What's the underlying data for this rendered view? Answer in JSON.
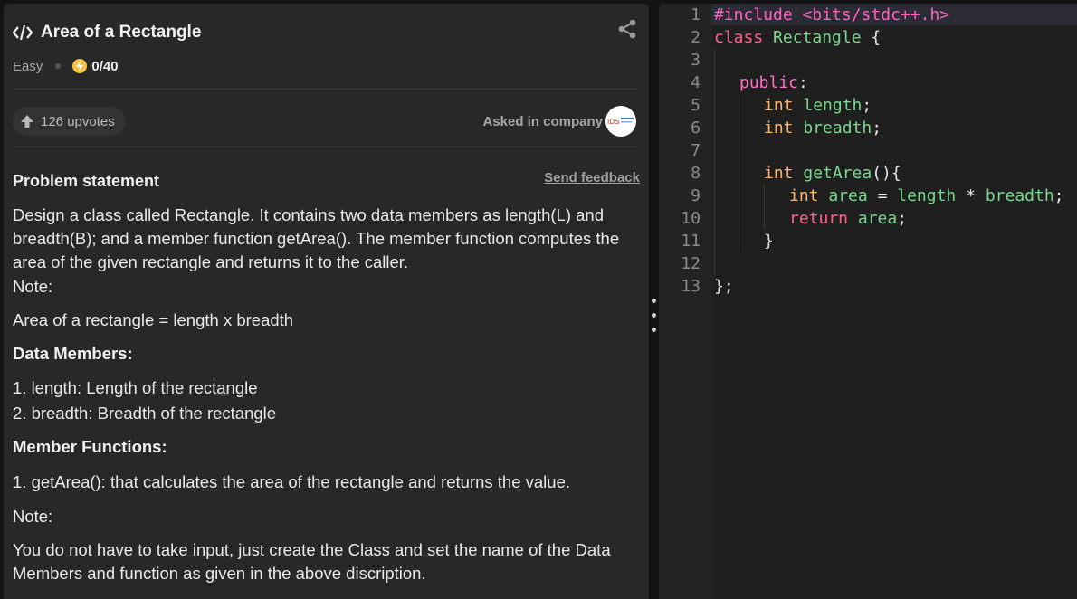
{
  "problem": {
    "title": "Area of a Rectangle",
    "difficulty": "Easy",
    "score": "0/40",
    "upvotes": "126 upvotes",
    "asked_label": "Asked in company",
    "company_logo_text": "IDS",
    "statement_heading": "Problem statement",
    "feedback_link": "Send feedback",
    "description": "Design a class called Rectangle. It contains two data members as length(L) and breadth(B); and a member function getArea(). The member function computes the area of the given rectangle and returns it to the caller.",
    "note_label": "Note:",
    "formula": "Area of a rectangle = length x breadth",
    "data_members_heading": "Data Members:",
    "data_members": [
      "1. length: Length of the rectangle",
      "2. breadth: Breadth of the rectangle"
    ],
    "member_functions_heading": "Member Functions:",
    "member_functions": [
      "1. getArea(): that calculates the area of the rectangle and returns the value."
    ],
    "note2_label": "Note:",
    "note2": "You do not have to take input, just create the Class and set the name of the Data Members and function as given in the above discription."
  },
  "editor": {
    "line_numbers": [
      "1",
      "2",
      "3",
      "4",
      "5",
      "6",
      "7",
      "8",
      "9",
      "10",
      "11",
      "12",
      "13"
    ],
    "code": {
      "l1": "#include <bits/stdc++.h>",
      "l2_kw": "class",
      "l2_name": "Rectangle",
      "l2_brace": "{",
      "l4": "public",
      "l5_type": "int",
      "l5_name": "length",
      "l6_type": "int",
      "l6_name": "breadth",
      "l8_type": "int",
      "l8_name": "getArea",
      "l8_rest": "(){",
      "l9_type": "int",
      "l9_name": "area",
      "l9_op": "=",
      "l9_a": "length",
      "l9_mul": "*",
      "l9_b": "breadth",
      "l10_kw": "return",
      "l10_name": "area",
      "l11": "}",
      "l13": "};"
    }
  },
  "icons": [
    "code-icon",
    "share-icon",
    "bolt-icon",
    "upvote-arrow-icon"
  ],
  "colors": {
    "panel": "#282828",
    "editor": "#1f1f1f",
    "accent": "#f6c443"
  }
}
